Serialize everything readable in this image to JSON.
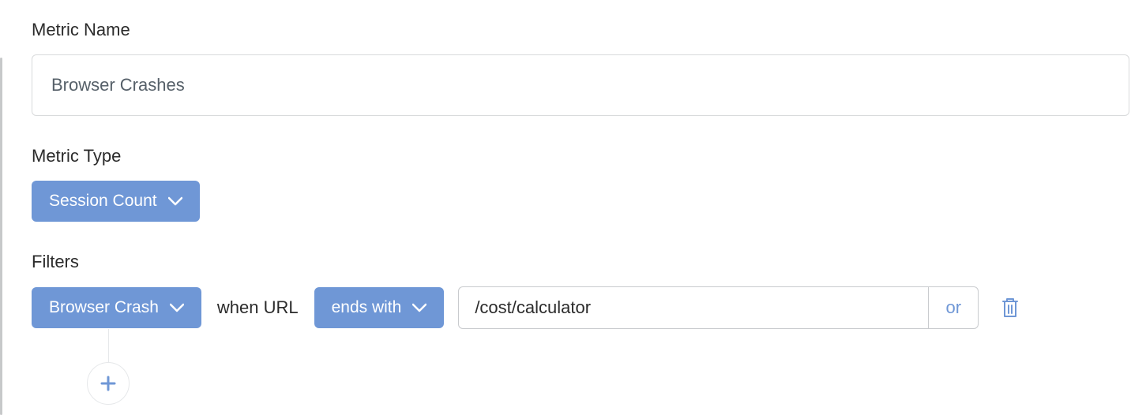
{
  "metric_name": {
    "label": "Metric Name",
    "value": "Browser Crashes"
  },
  "metric_type": {
    "label": "Metric Type",
    "selected": "Session Count"
  },
  "filters": {
    "label": "Filters",
    "rows": [
      {
        "event_selected": "Browser Crash",
        "when_text": "when URL",
        "operator_selected": "ends with",
        "value": "/cost/calculator",
        "or_label": "or"
      }
    ]
  },
  "colors": {
    "accent": "#6f97d6"
  }
}
